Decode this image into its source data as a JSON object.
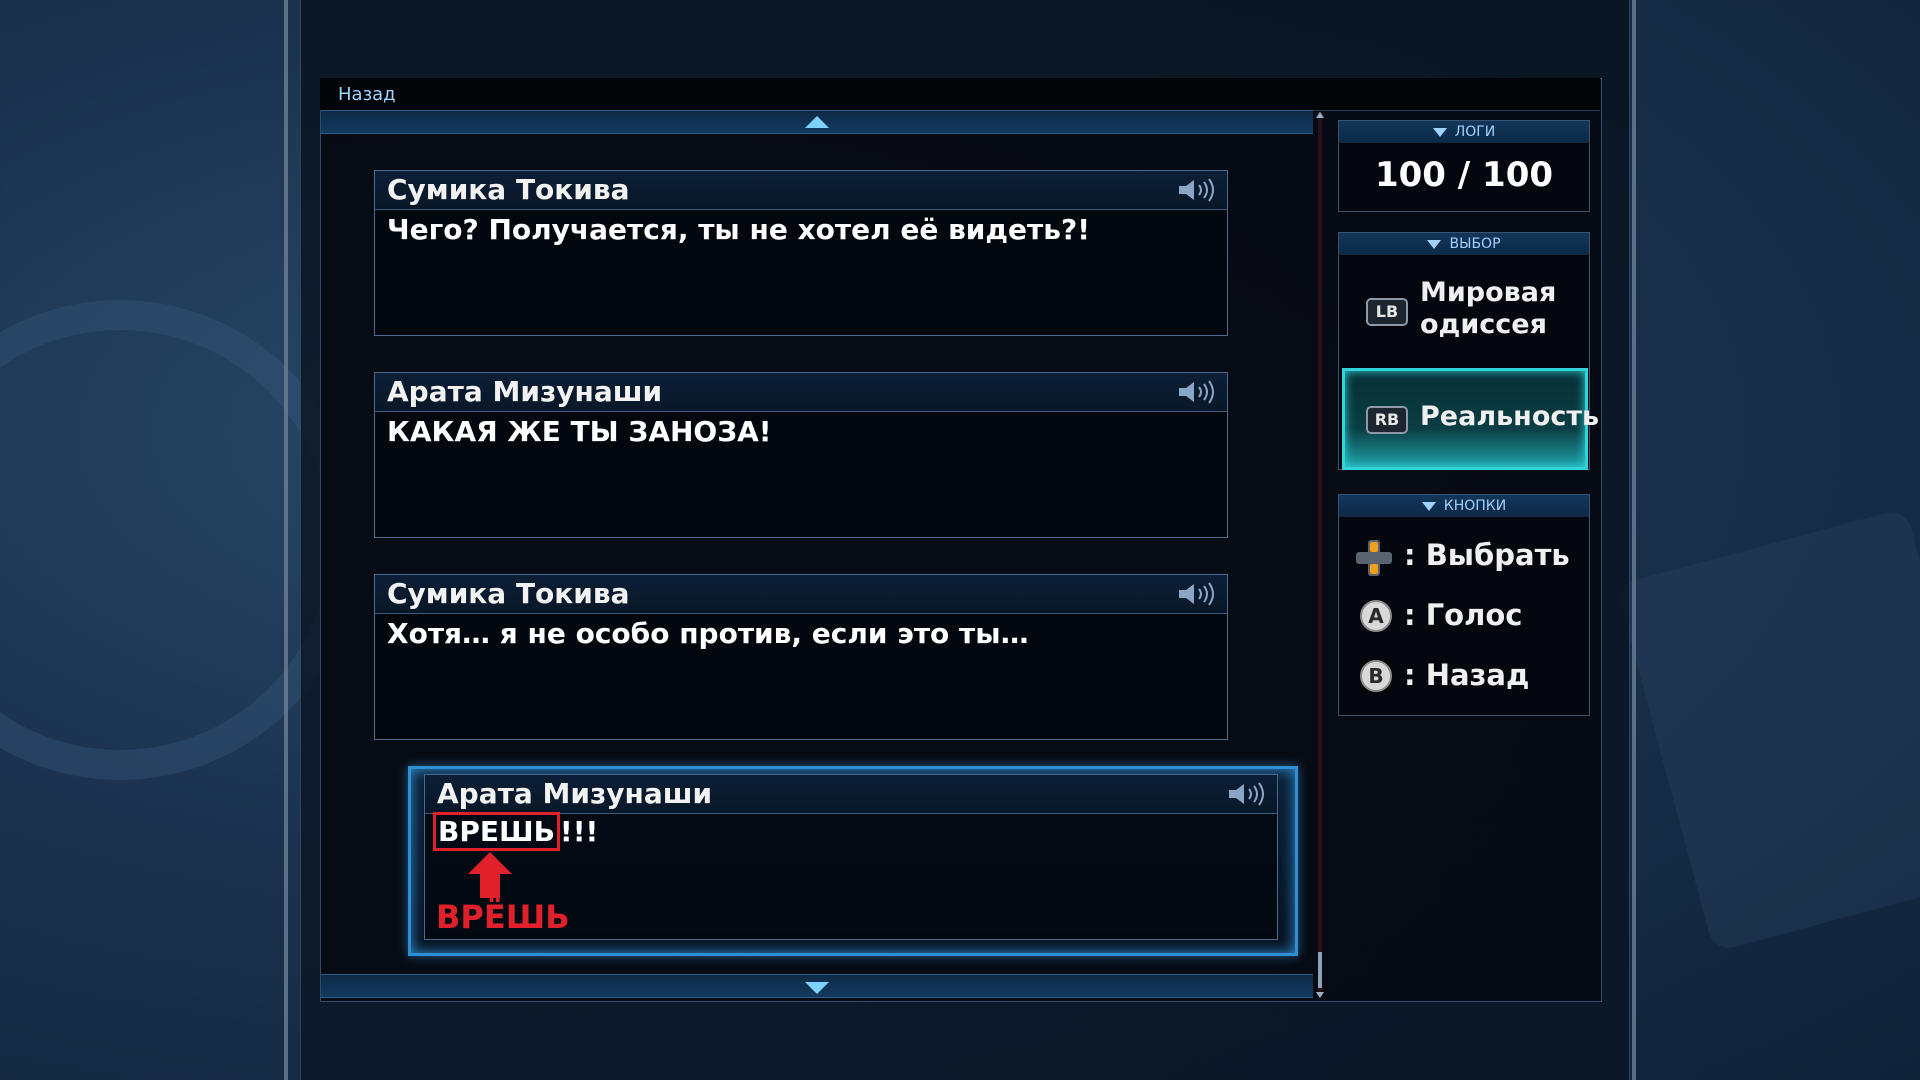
{
  "header": {
    "back_label": "Назад"
  },
  "log_entries": [
    {
      "speaker": "Сумика Токива",
      "text": "Чего? Получается, ты не хотел её видеть?!"
    },
    {
      "speaker": "Арата Мизунаши",
      "text": "КАКАЯ ЖЕ ТЫ ЗАНОЗА!"
    },
    {
      "speaker": "Сумика Токива",
      "text": "Хотя… я не особо против, если это ты…"
    },
    {
      "speaker": "Арата Мизунаши",
      "text_highlight": "ВРЕШЬ",
      "text_rest": "!!!"
    }
  ],
  "annotation": {
    "correction": "ВРЁШЬ"
  },
  "sidebar": {
    "logs": {
      "title": "ЛОГИ",
      "count": "100 / 100"
    },
    "choice": {
      "title": "ВЫБОР",
      "options": [
        {
          "button": "LB",
          "label_line1": "Мировая",
          "label_line2": "одиссея"
        },
        {
          "button": "RB",
          "label": "Реальность"
        }
      ]
    },
    "buttons": {
      "title": "КНОПКИ",
      "rows": [
        {
          "icon": "dpad-icon",
          "label": ": Выбрать"
        },
        {
          "button": "A",
          "label": ": Голос"
        },
        {
          "button": "B",
          "label": ": Назад"
        }
      ]
    }
  },
  "colors": {
    "accent": "#2f8fd4",
    "active_choice": "#2fd3d8",
    "annotation": "#e0202a"
  }
}
